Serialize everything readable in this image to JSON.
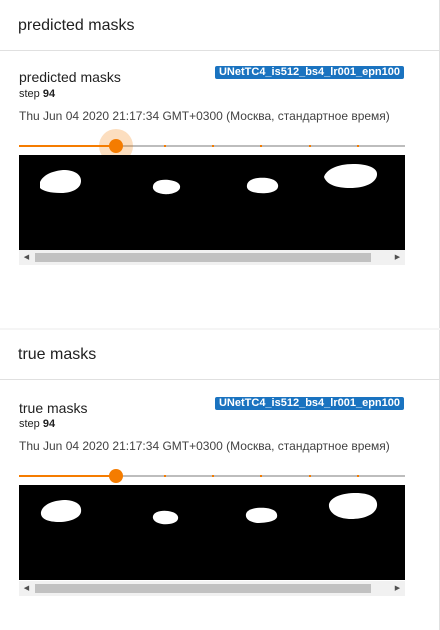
{
  "sections": [
    {
      "title": "predicted masks",
      "card": {
        "title": "predicted masks",
        "run": "UNetTC4_is512_bs4_lr001_epn100",
        "step_label": "step",
        "step": "94",
        "timestamp": "Thu Jun 04 2020 21:17:34 GMT+0300 (Москва, стандартное время)",
        "slider": {
          "value": 0.25,
          "focused": true
        }
      }
    },
    {
      "title": "true masks",
      "card": {
        "title": "true masks",
        "run": "UNetTC4_is512_bs4_lr001_epn100",
        "step_label": "step",
        "step": "94",
        "timestamp": "Thu Jun 04 2020 21:17:34 GMT+0300 (Москва, стандартное время)",
        "slider": {
          "value": 0.25,
          "focused": false
        }
      }
    }
  ],
  "colors": {
    "accent": "#f57c00",
    "run_badge": "#1a73c0",
    "mask_background": "#000000",
    "mask_foreground": "#ffffff"
  },
  "icons": {
    "scroll_left": "triangle-left",
    "scroll_right": "triangle-right"
  }
}
